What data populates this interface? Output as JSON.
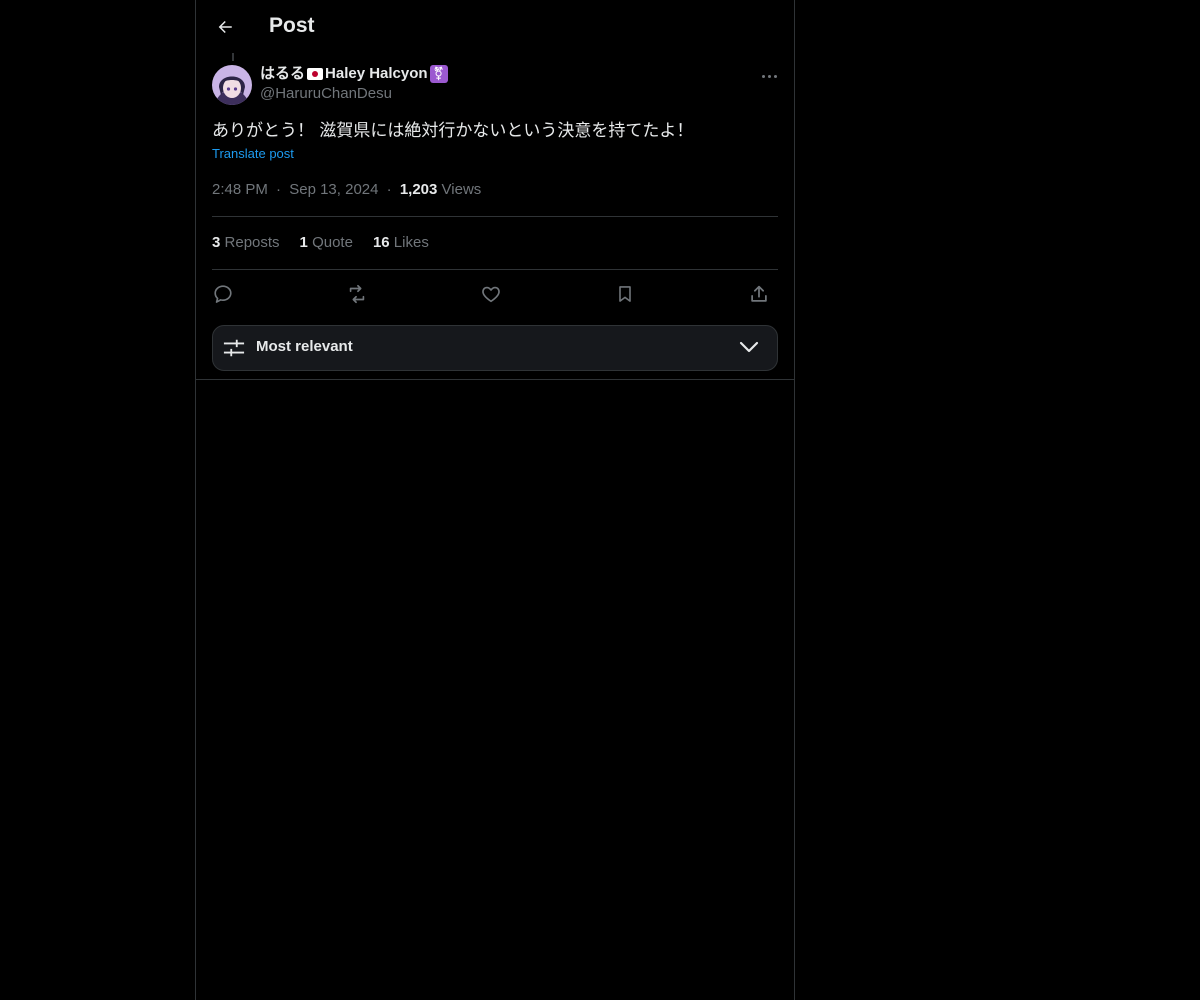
{
  "header": {
    "title": "Post",
    "back_icon": "arrow-left-icon"
  },
  "author": {
    "name_prefix": "はるる",
    "name_main": "Haley Halcyon",
    "flag_icon": "japan-flag-icon",
    "badge_icon": "transgender-symbol-icon",
    "badge_glyph": "⚧",
    "handle": "@HaruruChanDesu"
  },
  "post": {
    "text": "ありがとう！ 滋賀県には絶対行かないという決意を持てたよ！",
    "translate_label": "Translate post",
    "time": "2:48 PM",
    "date": "Sep 13, 2024",
    "separator": "·",
    "views_count": "1,203",
    "views_label": "Views"
  },
  "stats": {
    "reposts_count": "3",
    "reposts_label": "Reposts",
    "quotes_count": "1",
    "quotes_label": "Quote",
    "likes_count": "16",
    "likes_label": "Likes"
  },
  "actions": [
    "reply-icon",
    "repost-icon",
    "like-icon",
    "bookmark-icon",
    "share-icon"
  ],
  "sort": {
    "label": "Most relevant",
    "icon": "sliders-icon",
    "chevron": "chevron-down-icon"
  },
  "colors": {
    "accent": "#1d9bf0",
    "background": "#000000",
    "muted": "#71767b",
    "text": "#e7e9ea",
    "border": "#2f3336"
  }
}
